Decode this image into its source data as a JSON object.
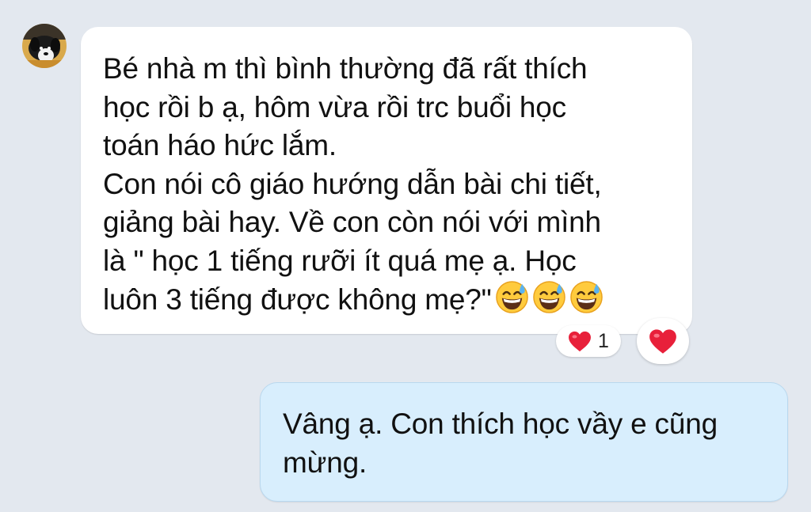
{
  "incoming_message": {
    "lines": [
      "Bé nhà m thì bình thường đã rất thích",
      "học rồi b ạ, hôm vừa rồi trc buổi học",
      "toán háo hức lắm.",
      "Con nói cô giáo hướng dẫn bài chi tiết,",
      "giảng bài hay. Về con còn nói với mình",
      "là \" học 1 tiếng rưỡi ít quá mẹ ạ. Học",
      "luôn 3 tiếng được không mẹ?\""
    ],
    "emojis": [
      "grinning-sweat-emoji",
      "grinning-sweat-emoji",
      "grinning-sweat-emoji"
    ],
    "reaction": {
      "icon": "heart-icon",
      "count": "1"
    }
  },
  "outgoing_message": {
    "lines": [
      "Vâng ạ. Con thích học vầy e cũng",
      "mừng."
    ]
  },
  "react_button": {
    "icon": "heart-icon"
  },
  "colors": {
    "background": "#e3e8ef",
    "incoming_bubble": "#ffffff",
    "outgoing_bubble": "#d8eefd",
    "heart": "#e8203a"
  }
}
